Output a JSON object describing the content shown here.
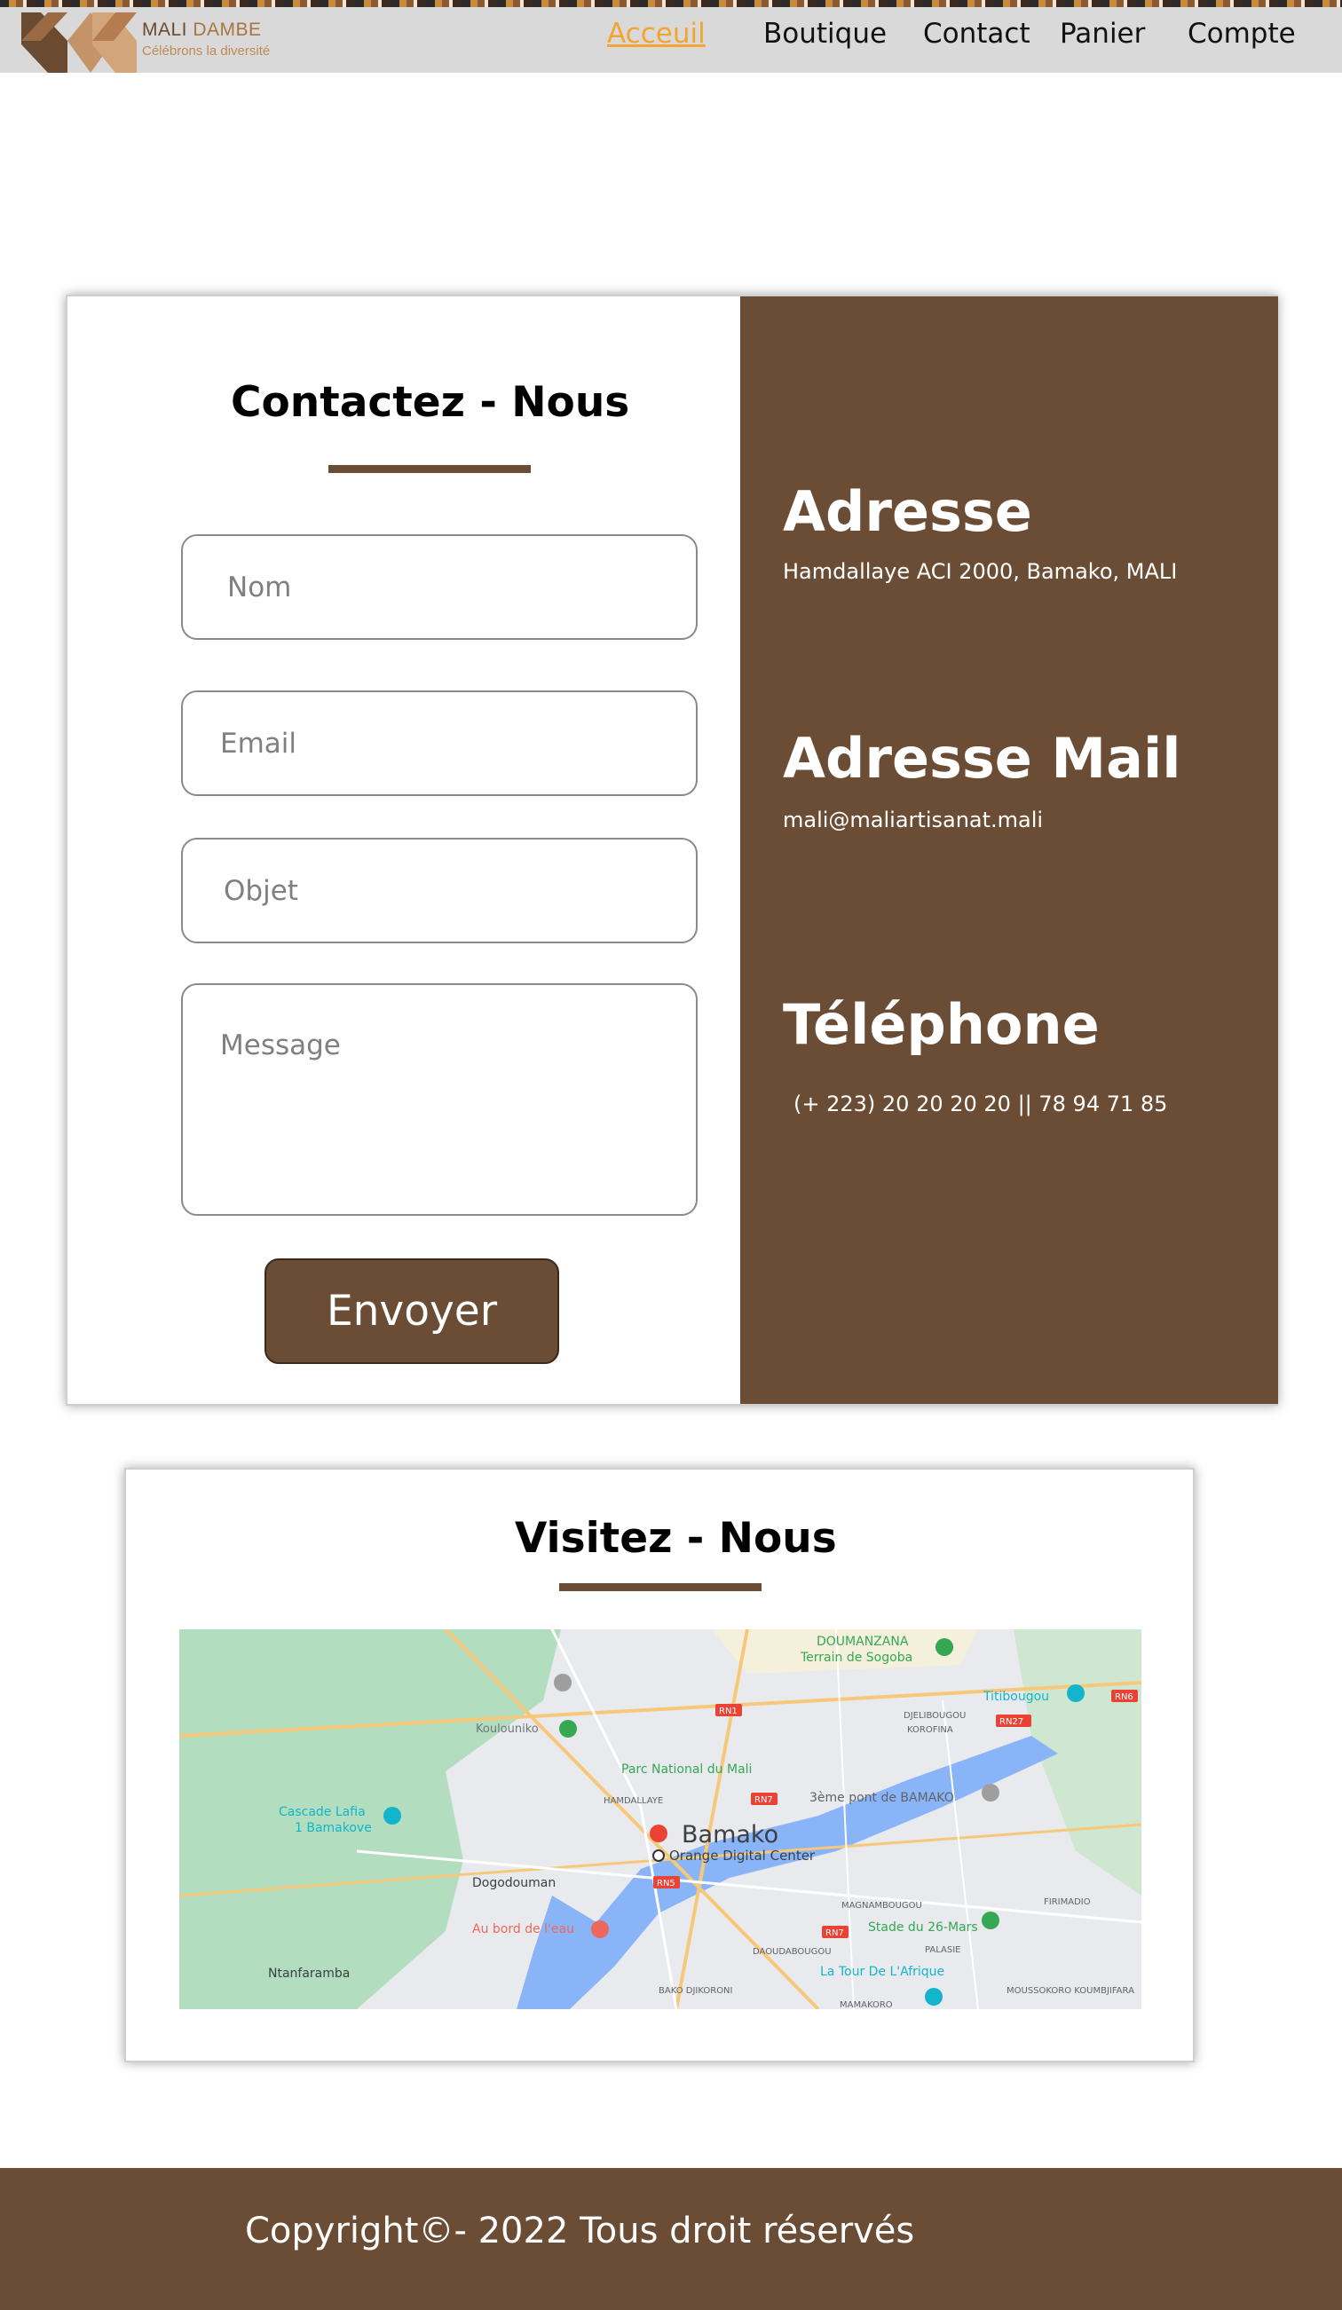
{
  "header": {
    "brand": {
      "name_part1": "MALI",
      "name_part2": "DAMBE",
      "tagline": "Célébrons la diversité"
    },
    "nav": [
      {
        "label": "Acceuil",
        "active": true
      },
      {
        "label": "Boutique",
        "active": false
      },
      {
        "label": "Contact",
        "active": false
      },
      {
        "label": "Panier",
        "active": false
      },
      {
        "label": "Compte",
        "active": false
      }
    ]
  },
  "contact": {
    "title": "Contactez - Nous",
    "fields": {
      "name_placeholder": "Nom",
      "email_placeholder": "Email",
      "subject_placeholder": "Objet",
      "message_placeholder": "Message"
    },
    "send_label": "Envoyer",
    "info": {
      "address_heading": "Adresse",
      "address": "Hamdallaye ACI 2000, Bamako, MALI",
      "mail_heading": "Adresse Mail",
      "mail": "mali@maliartisanat.mali",
      "phone_heading": "Téléphone",
      "phone": "(+ 223)  20 20 20 20 || 78 94 71 85"
    }
  },
  "visit": {
    "title": "Visitez - Nous",
    "map_labels": {
      "city": "Bamako",
      "pin": "Orange Digital Center",
      "places": [
        "DOUMANZANA",
        "Terrain de Sogoba",
        "Titibougou",
        "Koulouniko",
        "Parc National du Mali",
        "3ème pont de BAMAKO",
        "Cascade Lafia",
        "1 Bamakove",
        "Dogodouman",
        "Au bord de l'eau",
        "Stade du 26-Mars",
        "La Tour De L'Afrique",
        "Ntanfaramba",
        "HAMDALLAYE",
        "DJELIBOUGOU",
        "KOROFINA",
        "MAGNAMBOUGOU",
        "DAOUDABOUGOU",
        "BAKO DJIKORONI",
        "MOUSSOKORO KOUMBJIFARA",
        "FIRIMADIO",
        "PALASIE",
        "MAMAKORO"
      ],
      "roads": [
        "RN1",
        "RN27",
        "RN7",
        "RN5",
        "RN7",
        "RN6"
      ]
    }
  },
  "footer": {
    "copyright": "Copyright©- 2022 Tous droit réservés"
  },
  "colors": {
    "brown": "#6b4d35",
    "accent": "#f2a531",
    "header_bg": "#d9d9d9"
  }
}
